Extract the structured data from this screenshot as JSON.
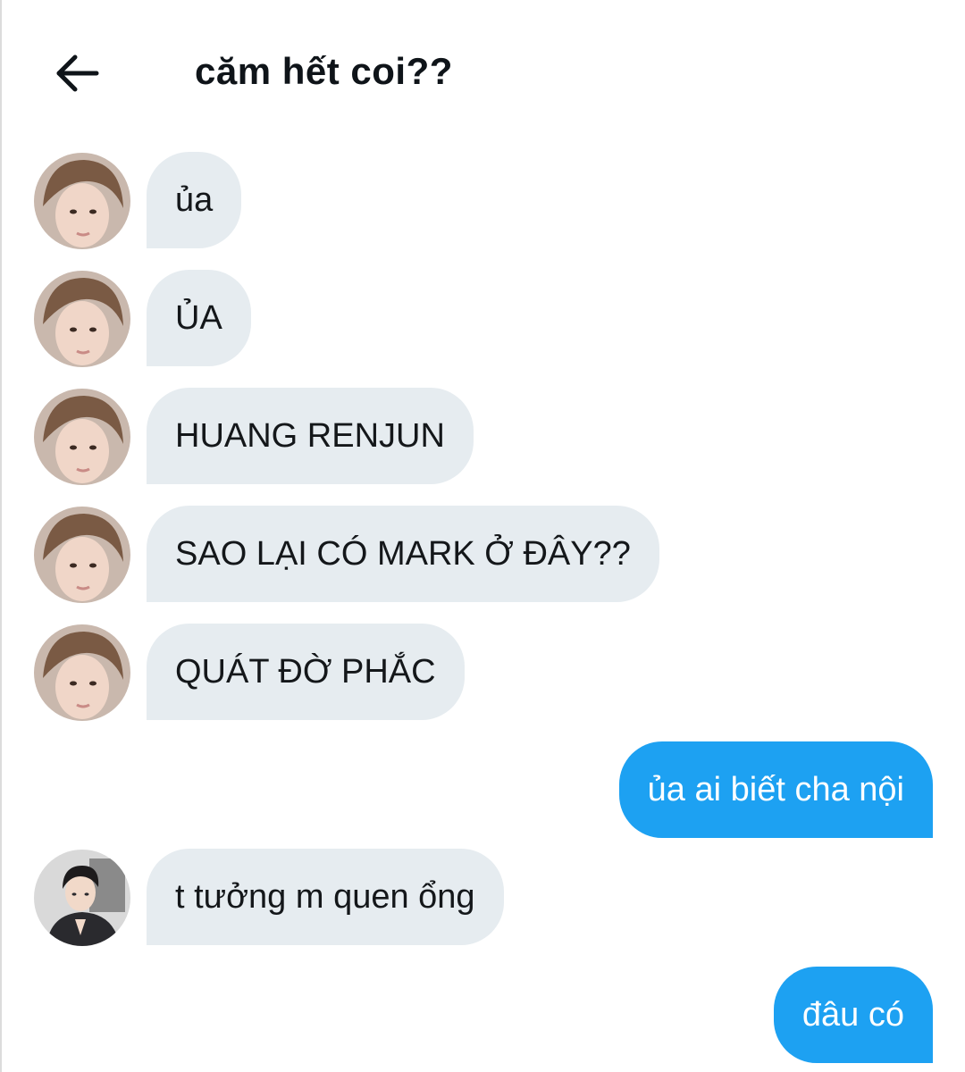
{
  "header": {
    "back_icon": "arrow-left-icon",
    "title": "căm hết coi??"
  },
  "colors": {
    "incoming_bubble": "#e6ecf0",
    "outgoing_bubble": "#1da1f2",
    "text_dark": "#14171a"
  },
  "messages": [
    {
      "sender": "other",
      "avatar": "avatar-1",
      "text": "ủa"
    },
    {
      "sender": "other",
      "avatar": "avatar-1",
      "text": "ỦA"
    },
    {
      "sender": "other",
      "avatar": "avatar-1",
      "text": "HUANG RENJUN"
    },
    {
      "sender": "other",
      "avatar": "avatar-1",
      "text": "SAO LẠI CÓ MARK Ở ĐÂY??"
    },
    {
      "sender": "other",
      "avatar": "avatar-1",
      "text": "QUÁT ĐỜ PHẮC"
    },
    {
      "sender": "me",
      "text": "ủa ai biết cha nội"
    },
    {
      "sender": "other",
      "avatar": "avatar-2",
      "text": "t tưởng m quen ổng"
    },
    {
      "sender": "me",
      "text": "đâu có"
    }
  ]
}
